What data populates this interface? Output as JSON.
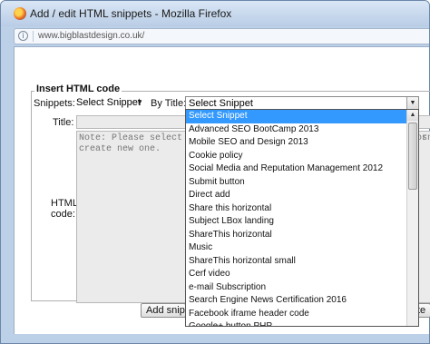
{
  "window": {
    "title": "Add / edit HTML snippets - Mozilla Firefox",
    "url": "www.bigblastdesign.co.uk/"
  },
  "form": {
    "legend": "Insert HTML code",
    "snippets_label": "Snippets:",
    "snippets_value": "Select Snippet",
    "by_title_label": "By Title:",
    "by_title_value": "Select Snippet",
    "title_label": "Title:",
    "code_label_line1": "HTML",
    "code_label_line2": "code:",
    "code_placeholder": "Note: Please select a snippet from the dropdown above to edit or\ncreate new one.",
    "add_button": "Add snippet",
    "right_button_fragment": "te",
    "side_fragment": "sn"
  },
  "dropdown": {
    "items": [
      "Select Snippet",
      "Advanced SEO BootCamp 2013",
      "Mobile SEO and Design 2013",
      "Cookie policy",
      "Social Media and Reputation Management 2012",
      "Submit button",
      "Direct add",
      "Share this horizontal",
      "Subject LBox landing",
      "ShareThis horizontal",
      "Music",
      "ShareThis horizontal small",
      "Cerf video",
      "e-mail Subscription",
      "Search Engine News Certification 2016",
      "Facebook iframe header code",
      "Google+ button PHP"
    ],
    "selected_index": 0
  },
  "colors": {
    "selection": "#3399ff",
    "window_frame": "#bcd0e8"
  }
}
